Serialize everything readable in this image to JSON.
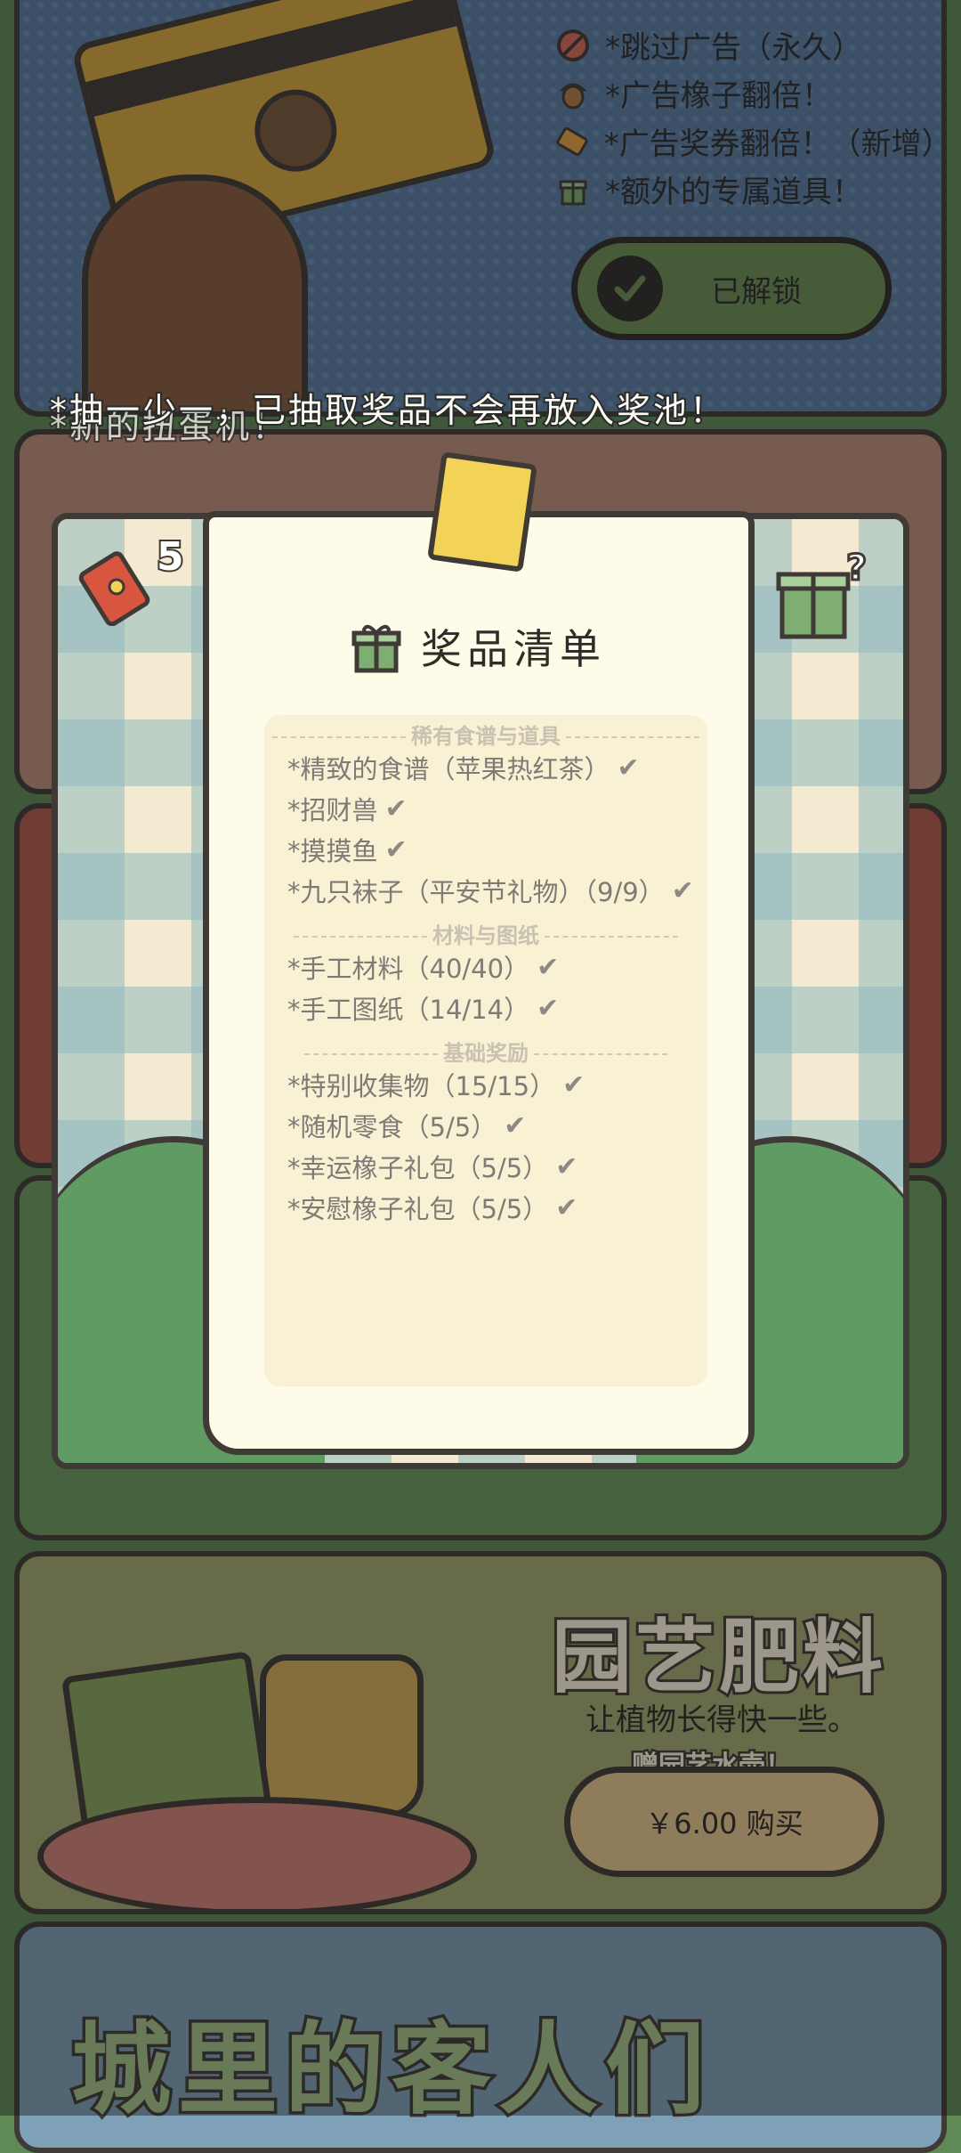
{
  "vip": {
    "perks": [
      "*跳过广告（永久）",
      "*广告橡子翻倍！",
      "*广告奖券翻倍！（新增）",
      "*额外的专属道具！"
    ],
    "unlock_label": "已解锁"
  },
  "gacha": {
    "hint": "*抽一少一，已抽取奖品不会再放入奖池！",
    "hint_behind": "*新的扭蛋机！",
    "ticket_count": "5"
  },
  "prize_popup": {
    "title": "奖品清单",
    "sections": [
      {
        "header": "稀有食谱与道具",
        "items": [
          "*精致的食谱（苹果热红茶）",
          "*招财兽",
          "*摸摸鱼",
          "*九只袜子（平安节礼物）（9/9）"
        ]
      },
      {
        "header": "材料与图纸",
        "items": [
          "*手工材料（40/40）",
          "*手工图纸（14/14）"
        ]
      },
      {
        "header": "基础奖励",
        "items": [
          "*特别收集物（15/15）",
          "*随机零食（5/5）",
          "*幸运橡子礼包（5/5）",
          "*安慰橡子礼包（5/5）"
        ]
      }
    ]
  },
  "fertilizer": {
    "title": "园艺肥料",
    "description": "让植物长得快一些。",
    "badge": "赠园艺水壶！",
    "buy_label": "￥6.00 购买"
  },
  "guests": {
    "title": "城里的客人们"
  },
  "colors": {
    "background": "#5f8a55",
    "outline": "#3f3a36",
    "paper": "#fefbe8",
    "unlock_button": "#6e8f53",
    "buy_button": "#e8c98e"
  }
}
